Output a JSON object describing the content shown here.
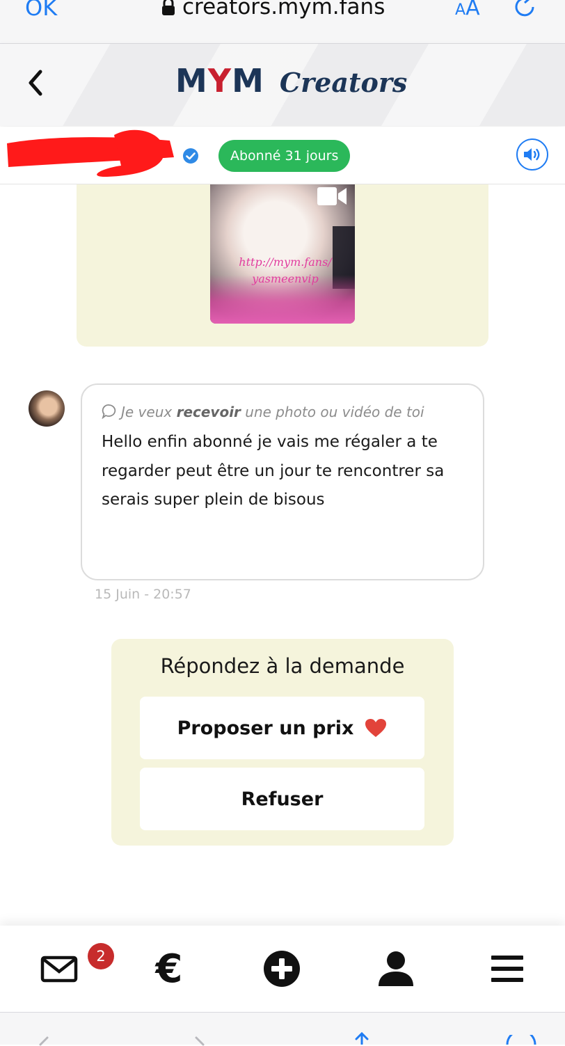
{
  "browser": {
    "done_label": "OK",
    "url": "creators.mym.fans",
    "text_size_small": "A",
    "text_size_large": "A"
  },
  "header": {
    "logo_brand_start": "M",
    "logo_brand_y": "Y",
    "logo_brand_end": "M",
    "logo_sub": "Creators"
  },
  "chat_header": {
    "subscription_badge": "Abonné 31 jours"
  },
  "media": {
    "watermark_line1": "http://mym.fans/",
    "watermark_line2": "yasmeenvip"
  },
  "message": {
    "request_prefix": "Je veux",
    "request_emphasis": "recevoir",
    "request_suffix": "une photo ou vidéo de toi",
    "text": "Hello enfin abonné je vais me régaler a te regarder peut être un jour te rencontrer sa serais super plein de bisous",
    "timestamp": "15 Juin - 20:57"
  },
  "request_panel": {
    "title": "Répondez à la demande",
    "propose_label": "Proposer un prix",
    "refuse_label": "Refuser"
  },
  "bottom_nav": {
    "messages_badge": "2",
    "euro_symbol": "€"
  },
  "colors": {
    "accent_blue": "#1f7cf3",
    "brand_navy": "#1c3557",
    "brand_red": "#c8202f",
    "badge_green": "#2bb85a",
    "panel_cream": "#f5f4dc",
    "heart_red": "#e2433a"
  },
  "icons": [
    "lock-icon",
    "reload-icon",
    "back-chevron-icon",
    "verified-icon",
    "speaker-icon",
    "video-camera-icon",
    "comment-icon",
    "heart-icon",
    "mail-icon",
    "euro-icon",
    "plus-circle-icon",
    "user-icon",
    "menu-icon"
  ]
}
